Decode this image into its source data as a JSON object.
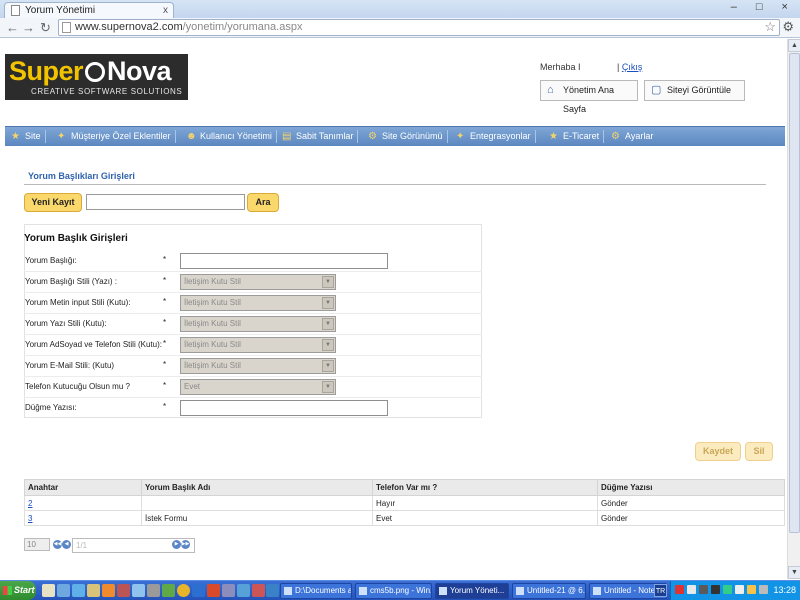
{
  "browser": {
    "tab_title": "Yorum Yönetimi",
    "tab_close": "x",
    "url_host": "www.supernova2.com",
    "url_path": "/yonetim/yorumana.aspx",
    "window_buttons": "– □ ×"
  },
  "logo": {
    "part1": "Super",
    "part2": "Nova",
    "tagline": "CREATIVE SOFTWARE SOLUTIONS"
  },
  "header": {
    "greeting": "Merhaba I",
    "separator": " | ",
    "logout": "Çıkış",
    "admin_home": "Yönetim Ana Sayfa",
    "view_site": "Siteyi Görüntüle"
  },
  "menu": {
    "items": [
      "Site",
      "Müşteriye Özel Eklentiler",
      "Kullanıcı Yönetimi",
      "Sabit Tanımlar",
      "Site Görünümü",
      "Entegrasyonlar",
      "E-Ticaret",
      "Ayarlar"
    ]
  },
  "page": {
    "title": "Yorum Başlıkları Girişleri",
    "new_button": "Yeni Kayıt",
    "search_button": "Ara",
    "search_value": ""
  },
  "form": {
    "title": "Yorum Başlık Girişleri",
    "required_mark": "*",
    "fields": [
      {
        "label": "Yorum Başlığı:",
        "type": "text",
        "value": ""
      },
      {
        "label": "Yorum Başlığı Stili (Yazı) :",
        "type": "select",
        "value": "İletişim Kutu Stil"
      },
      {
        "label": "Yorum Metin input Stili (Kutu):",
        "type": "select",
        "value": "İletişim Kutu Stil"
      },
      {
        "label": "Yorum Yazı Stili (Kutu):",
        "type": "select",
        "value": "İletişim Kutu Stil"
      },
      {
        "label": "Yorum AdSoyad ve Telefon Stili (Kutu):",
        "type": "select",
        "value": "İletişim Kutu Stil"
      },
      {
        "label": "Yorum E-Mail Stili: (Kutu)",
        "type": "select",
        "value": "İletişim Kutu Stil"
      },
      {
        "label": "Telefon Kutucuğu Olsun mu ?",
        "type": "select",
        "value": "Evet"
      },
      {
        "label": "Düğme Yazısı:",
        "type": "text",
        "value": ""
      }
    ],
    "save": "Kaydet",
    "delete": "Sil"
  },
  "table": {
    "headers": [
      "Anahtar",
      "Yorum Başlık Adı",
      "Telefon Var mı ?",
      "Düğme Yazısı"
    ],
    "rows": [
      [
        "2",
        "",
        "Hayır",
        "Gönder"
      ],
      [
        "3",
        "İstek Formu",
        "Evet",
        "Gönder"
      ]
    ]
  },
  "pager": {
    "page_size": "10",
    "page_text": "1/1"
  },
  "taskbar": {
    "start": "Start",
    "tasks": [
      "D:\\Documents a...",
      "cms5b.png - Win...",
      "Yorum Yöneti...",
      "Untitled-21 @ 6...",
      "Untitled - Notepad"
    ],
    "lang": "TR",
    "clock": "13:28"
  },
  "colors": {
    "menu": "#6b96cc",
    "accent_button": "#fbd86c",
    "title_blue": "#2f63ad"
  }
}
